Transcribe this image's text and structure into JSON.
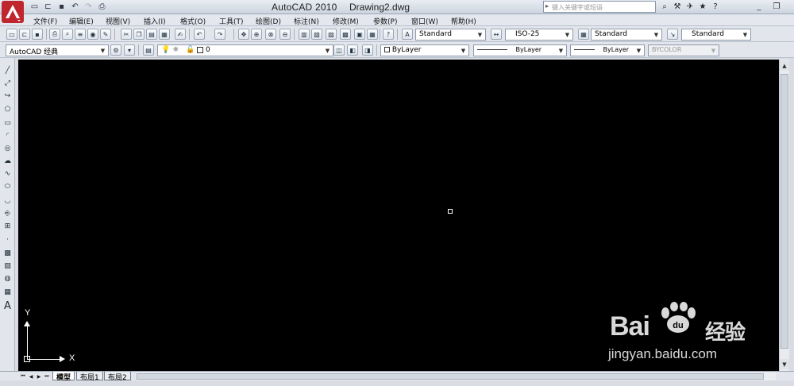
{
  "app": {
    "title": "AutoCAD 2010",
    "document": "Drawing2.dwg",
    "accent_color": "#c0262d"
  },
  "search": {
    "placeholder": "键入关键字或短语"
  },
  "quick_access": [
    "new-icon",
    "open-icon",
    "save-icon",
    "undo-icon",
    "redo-icon",
    "plot-icon"
  ],
  "window_controls": {
    "minimize": "_",
    "restore": "❐"
  },
  "menu": [
    "文件(F)",
    "编辑(E)",
    "视图(V)",
    "插入(I)",
    "格式(O)",
    "工具(T)",
    "绘图(D)",
    "标注(N)",
    "修改(M)",
    "参数(P)",
    "窗口(W)",
    "帮助(H)"
  ],
  "styles": {
    "text_style": "Standard",
    "dim_style": "ISO-25",
    "table_style": "Standard",
    "multileader_style": "Standard"
  },
  "workspace": {
    "name": "AutoCAD 经典"
  },
  "layer": {
    "current": "0"
  },
  "properties": {
    "color": "ByLayer",
    "linetype": "ByLayer",
    "lineweight": "ByLayer",
    "plotstyle": "BYCOLOR"
  },
  "draw_tools": [
    "line-icon",
    "construction-line-icon",
    "polyline-icon",
    "polygon-icon",
    "rectangle-icon",
    "arc-icon",
    "circle-icon",
    "revision-cloud-icon",
    "spline-icon",
    "ellipse-icon",
    "ellipse-arc-icon",
    "insert-block-icon",
    "make-block-icon",
    "point-icon",
    "hatch-icon",
    "gradient-icon",
    "region-icon",
    "table-icon",
    "multiline-text-icon"
  ],
  "ucs": {
    "x_label": "X",
    "y_label": "Y"
  },
  "tabs": [
    "模型",
    "布局1",
    "布局2"
  ],
  "watermark": {
    "brand": "Bai",
    "brand_suffix": "经验",
    "url": "jingyan.baidu.com"
  }
}
